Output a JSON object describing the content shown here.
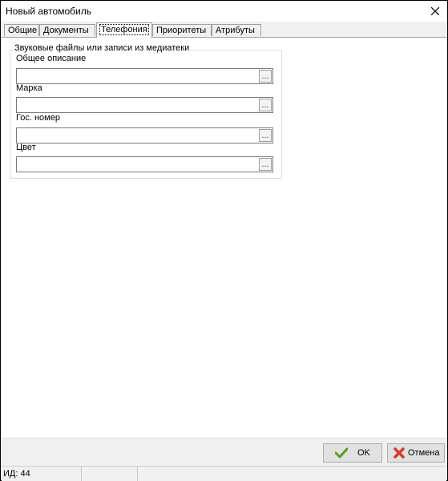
{
  "window": {
    "title": "Новый автомобиль",
    "close_icon": "close-icon"
  },
  "tabs": [
    {
      "label": "Общие",
      "active": false
    },
    {
      "label": "Документы",
      "active": false
    },
    {
      "label": "Телефония",
      "active": true
    },
    {
      "label": "Приоритеты",
      "active": false
    },
    {
      "label": "Атрибуты",
      "active": false
    }
  ],
  "group": {
    "title": "Звуковые файлы или записи из медиатеки",
    "fields": [
      {
        "label": "Общее описание",
        "value": "",
        "button_text": "..."
      },
      {
        "label": "Марка",
        "value": "",
        "button_text": "..."
      },
      {
        "label": "Гос. номер",
        "value": "",
        "button_text": "..."
      },
      {
        "label": "Цвет",
        "value": "",
        "button_text": "..."
      }
    ]
  },
  "buttons": {
    "ok_label": "OK",
    "cancel_label": "Отмена",
    "ok_icon": "checkmark-icon",
    "cancel_icon": "red-x-icon"
  },
  "status": {
    "id_text": "ИД: 44",
    "cell2": "",
    "cell3": ""
  },
  "colors": {
    "ok_check": "#5a9e1f",
    "cancel_x": "#d83a2a"
  }
}
